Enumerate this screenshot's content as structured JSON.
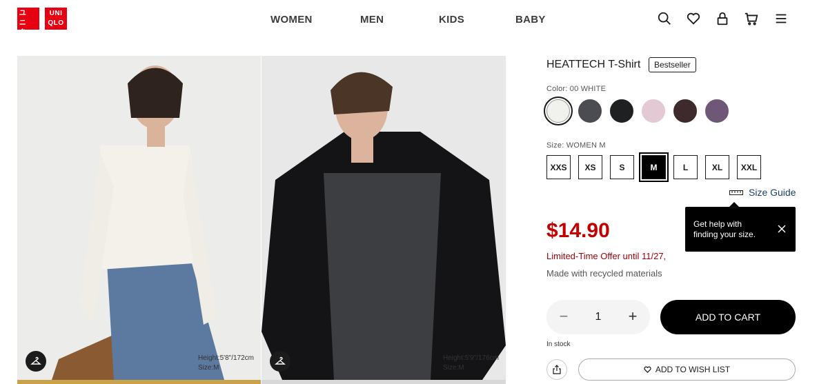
{
  "brand": {
    "logo_left": [
      "ユニ",
      "クロ"
    ],
    "logo_right": [
      "UNI",
      "QLO"
    ],
    "color": "#e60012"
  },
  "nav": {
    "items": [
      "WOMEN",
      "MEN",
      "KIDS",
      "BABY"
    ]
  },
  "header_icons": [
    "search-icon",
    "heart-icon",
    "account-icon",
    "cart-icon",
    "menu-icon"
  ],
  "gallery": {
    "images": [
      {
        "model_height": "Height:5'8\"/172cm",
        "model_size": "Size:M"
      },
      {
        "model_height": "Height:5'9\"/176cm",
        "model_size": "Size:M"
      }
    ]
  },
  "product": {
    "title": "HEATTECH T-Shirt",
    "badge": "Bestseller",
    "color_label": "Color: 00 WHITE",
    "colors": [
      {
        "name": "white",
        "hex": "#f1f1ee",
        "selected": true
      },
      {
        "name": "dark-gray",
        "hex": "#4a4c52",
        "selected": false
      },
      {
        "name": "black",
        "hex": "#1f2022",
        "selected": false
      },
      {
        "name": "pink",
        "hex": "#e3c9d4",
        "selected": false
      },
      {
        "name": "dark-brown",
        "hex": "#3e2a2d",
        "selected": false
      },
      {
        "name": "purple",
        "hex": "#6f5877",
        "selected": false
      }
    ],
    "size_label": "Size: WOMEN M",
    "sizes": [
      "XXS",
      "XS",
      "S",
      "M",
      "L",
      "XL",
      "XXL"
    ],
    "selected_size": "M",
    "size_guide": "Size Guide",
    "tooltip": "Get help with finding your size.",
    "price": "$14.90",
    "price_color": "#c20000",
    "offer": "Limited-Time Offer until 11/27,",
    "made_with": "Made with recycled materials",
    "quantity": "1",
    "qty_minus": "−",
    "qty_plus": "+",
    "add_to_cart": "ADD TO CART",
    "stock": "In stock",
    "wish_list": "ADD TO WISH LIST"
  }
}
